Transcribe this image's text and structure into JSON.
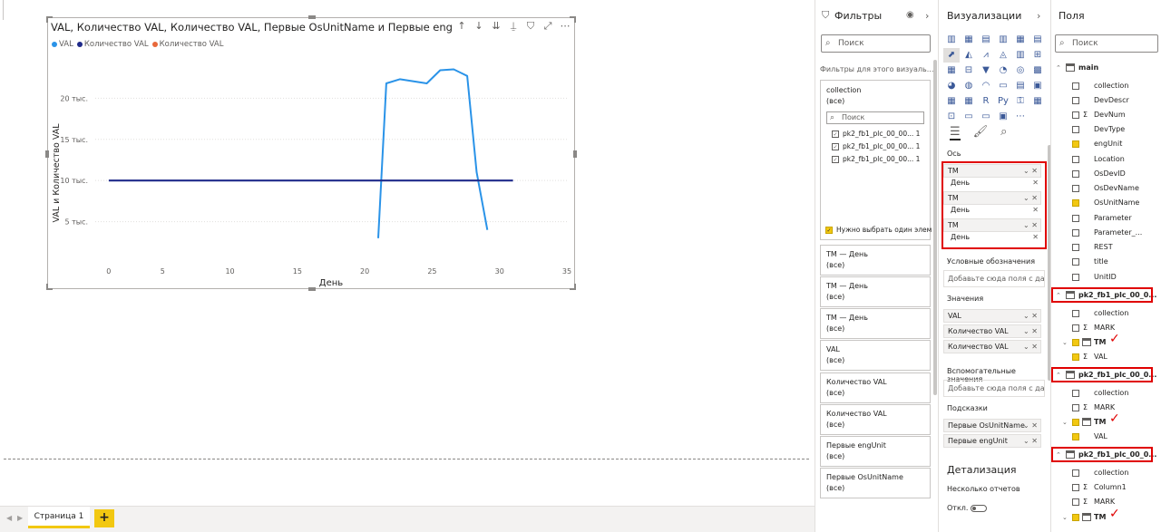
{
  "visual": {
    "title": "VAL, Количество VAL, Количество VAL, Первые OsUnitName и Первые engUnit",
    "legend": [
      {
        "label": "VAL",
        "color": "#2a93e8"
      },
      {
        "label": "Количество VAL",
        "color": "#1f2a8a"
      },
      {
        "label": "Количество VAL",
        "color": "#e8683a"
      }
    ],
    "toolbar_icons": [
      "pin-icon",
      "drill-down-icon",
      "expand-all-icon",
      "hierarchy-icon",
      "filter-icon",
      "focus-mode-icon",
      "more-options-icon"
    ]
  },
  "chart_data": {
    "type": "line",
    "xlabel": "День",
    "ylabel": "VAL и Количество VAL",
    "x_ticks": [
      "5",
      "10",
      "15",
      "20",
      "25",
      "30",
      "35"
    ],
    "y_ticks": [
      "5 тыс.",
      "10 тыс.",
      "15 тыс.",
      "20 тыс."
    ],
    "xlim": [
      0,
      35
    ],
    "ylim": [
      0,
      24000
    ],
    "grid": true,
    "legend_position": "top-left",
    "series": [
      {
        "name": "VAL",
        "color": "#2a93e8",
        "x": [
          21,
          21.6,
          22.6,
          24.6,
          25.6,
          26.6,
          27.6,
          28.3,
          29.1
        ],
        "y": [
          3000,
          21800,
          22300,
          21800,
          23400,
          23500,
          22700,
          11000,
          4000
        ]
      },
      {
        "name": "Количество VAL",
        "color": "#1f2a8a",
        "x": [
          1,
          31
        ],
        "y": [
          10000,
          10000
        ]
      }
    ]
  },
  "pagebar": {
    "page_label": "Страница 1",
    "add_label": "+"
  },
  "filters": {
    "title": "Фильтры",
    "search_placeholder": "Поиск",
    "scope_label": "Фильтры для этого визуаль...",
    "main_card": {
      "title": "collection",
      "value": "(все)",
      "search": "Поиск",
      "items": [
        {
          "label": "pk2_fb1_plc_00_00...",
          "count": "1"
        },
        {
          "label": "pk2_fb1_plc_00_00...",
          "count": "1"
        },
        {
          "label": "pk2_fb1_plc_00_00...",
          "count": "1"
        }
      ],
      "require_label": "Нужно выбрать один элем"
    },
    "cards": [
      {
        "title": "TM — День",
        "value": "(все)"
      },
      {
        "title": "TM — День",
        "value": "(все)"
      },
      {
        "title": "TM — День",
        "value": "(все)"
      },
      {
        "title": "VAL",
        "value": "(все)"
      },
      {
        "title": "Количество VAL",
        "value": "(все)"
      },
      {
        "title": "Количество VAL",
        "value": "(все)"
      },
      {
        "title": "Первые engUnit",
        "value": "(все)"
      },
      {
        "title": "Первые OsUnitName",
        "value": "(все)"
      }
    ]
  },
  "viz": {
    "title": "Визуализации",
    "icons": [
      "▥",
      "▦",
      "▤",
      "▥",
      "▦",
      "▤",
      "⬈",
      "◭",
      "⩘",
      "◬",
      "▥",
      "⊞",
      "▦",
      "⊟",
      "▼",
      "◔",
      "◎",
      "▩",
      "◕",
      "◍",
      "◠",
      "▭",
      "▤",
      "▣",
      "▦",
      "▦",
      "R",
      "Py",
      "⚿",
      "▦",
      "⊡",
      "▭",
      "▭",
      "▣",
      "⋯"
    ],
    "axis_label": "Ось",
    "axis_items": [
      {
        "field": "TM",
        "sub": "День"
      },
      {
        "field": "TM",
        "sub": "День"
      },
      {
        "field": "TM",
        "sub": "День"
      }
    ],
    "legend_label": "Условные обозначения",
    "legend_drop": "Добавьте сюда поля с дан...",
    "values_label": "Значения",
    "values_items": [
      "VAL",
      "Количество VAL",
      "Количество VAL"
    ],
    "secondary_label": "Вспомогательные значения",
    "secondary_drop": "Добавьте сюда поля с дан...",
    "tooltips_label": "Подсказки",
    "tooltips_items": [
      "Первые OsUnitName",
      "Первые engUnit"
    ],
    "drill_label": "Детализация",
    "cross_report_label": "Несколько отчетов",
    "toggle_label": "Откл."
  },
  "fields": {
    "title": "Поля",
    "search_placeholder": "Поиск",
    "rows": [
      {
        "kind": "table",
        "label": "main",
        "y": 71
      },
      {
        "kind": "field",
        "label": "collection",
        "checked": false,
        "sigma": false,
        "y": 91
      },
      {
        "kind": "field",
        "label": "DevDescr",
        "checked": false,
        "sigma": false,
        "y": 107
      },
      {
        "kind": "field",
        "label": "DevNum",
        "checked": false,
        "sigma": true,
        "y": 123
      },
      {
        "kind": "field",
        "label": "DevType",
        "checked": false,
        "sigma": false,
        "y": 139
      },
      {
        "kind": "field",
        "label": "engUnit",
        "checked": true,
        "sigma": false,
        "y": 155
      },
      {
        "kind": "field",
        "label": "Location",
        "checked": false,
        "sigma": false,
        "y": 172
      },
      {
        "kind": "field",
        "label": "OsDevID",
        "checked": false,
        "sigma": false,
        "y": 188
      },
      {
        "kind": "field",
        "label": "OsDevName",
        "checked": false,
        "sigma": false,
        "y": 204
      },
      {
        "kind": "field",
        "label": "OsUnitName",
        "checked": true,
        "sigma": false,
        "y": 220
      },
      {
        "kind": "field",
        "label": "Parameter",
        "checked": false,
        "sigma": false,
        "y": 237
      },
      {
        "kind": "field",
        "label": "Parameter_...",
        "checked": false,
        "sigma": false,
        "y": 253
      },
      {
        "kind": "field",
        "label": "REST",
        "checked": false,
        "sigma": false,
        "y": 269
      },
      {
        "kind": "field",
        "label": "title",
        "checked": false,
        "sigma": false,
        "y": 285
      },
      {
        "kind": "field",
        "label": "UnitID",
        "checked": false,
        "sigma": false,
        "y": 302
      },
      {
        "kind": "table",
        "label": "pk2_fb1_plc_00_0...",
        "y": 322,
        "boxed": true
      },
      {
        "kind": "field",
        "label": "collection",
        "checked": false,
        "sigma": false,
        "y": 342
      },
      {
        "kind": "field",
        "label": "MARK",
        "checked": false,
        "sigma": true,
        "y": 358
      },
      {
        "kind": "hier",
        "label": "TM",
        "checked": true,
        "y": 374,
        "tick": true
      },
      {
        "kind": "field",
        "label": "VAL",
        "checked": true,
        "sigma": true,
        "y": 390
      },
      {
        "kind": "table",
        "label": "pk2_fb1_plc_00_0...",
        "y": 410,
        "boxed": true
      },
      {
        "kind": "field",
        "label": "collection",
        "checked": false,
        "sigma": false,
        "y": 430
      },
      {
        "kind": "field",
        "label": "MARK",
        "checked": false,
        "sigma": true,
        "y": 446
      },
      {
        "kind": "hier",
        "label": "TM",
        "checked": true,
        "y": 462,
        "tick": true
      },
      {
        "kind": "field",
        "label": "VAL",
        "checked": true,
        "sigma": false,
        "y": 478
      },
      {
        "kind": "table",
        "label": "pk2_fb1_plc_00_0...",
        "y": 498,
        "boxed": true
      },
      {
        "kind": "field",
        "label": "collection",
        "checked": false,
        "sigma": false,
        "y": 518
      },
      {
        "kind": "field",
        "label": "Column1",
        "checked": false,
        "sigma": true,
        "y": 534
      },
      {
        "kind": "field",
        "label": "MARK",
        "checked": false,
        "sigma": true,
        "y": 550
      },
      {
        "kind": "hier",
        "label": "TM",
        "checked": true,
        "y": 567,
        "tick": true
      }
    ]
  }
}
